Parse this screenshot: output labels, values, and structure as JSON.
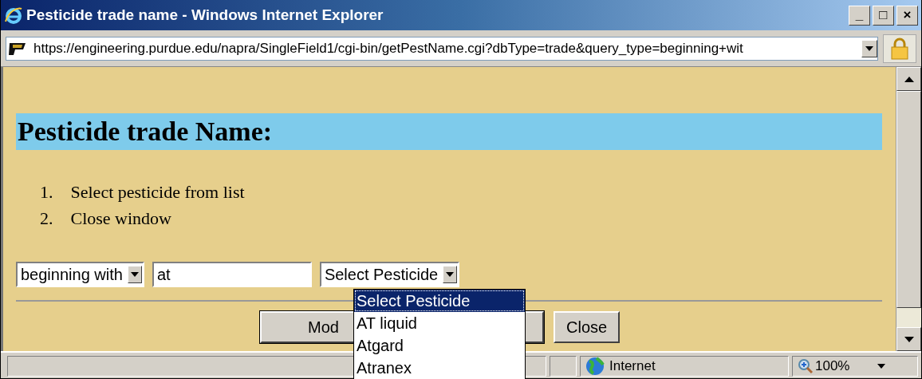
{
  "window": {
    "title": "Pesticide trade name - Windows Internet Explorer",
    "buttons": [
      "_",
      "□",
      "×"
    ]
  },
  "address_bar": {
    "url": "https://engineering.purdue.edu/napra/SingleField1/cgi-bin/getPestName.cgi?dbType=trade&query_type=beginning+wit"
  },
  "page": {
    "heading": "Pesticide trade Name:",
    "steps": [
      {
        "number": "1.",
        "text": "Select pesticide from list"
      },
      {
        "number": "2.",
        "text": "Close window"
      }
    ],
    "match_select": {
      "value": "beginning with"
    },
    "query_field": {
      "value": "at"
    },
    "pesticide_select": {
      "value": "Select Pesticide",
      "expanded": true,
      "options": [
        {
          "label": "Select Pesticide",
          "selected": true
        },
        {
          "label": "AT liquid",
          "selected": false
        },
        {
          "label": "Atgard",
          "selected": false
        },
        {
          "label": "Atranex",
          "selected": false
        }
      ]
    },
    "buttons": [
      {
        "label": "Mod"
      },
      {
        "label": "Close"
      }
    ]
  },
  "status_bar": {
    "zone": "Internet",
    "zoom": "100%"
  }
}
